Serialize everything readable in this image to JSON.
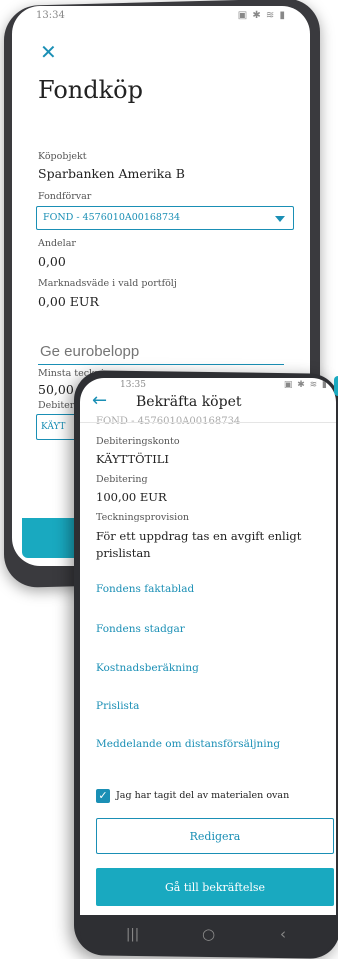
{
  "back_screen": {
    "status_time": "13:34",
    "status_icons": "▣ ✱ ≋ ▮",
    "title": "Fondköp",
    "kopobjekt_label": "Köpobjekt",
    "kopobjekt_value": "Sparbanken Amerika B",
    "fondforvar_label": "Fondförvar",
    "fondforvar_value": "FOND - 4576010A00168734",
    "andelar_label": "Andelar",
    "andelar_value": "0,00",
    "marknadsvarde_label": "Marknadsväde i vald portfölj",
    "marknadsvarde_value": "0,00 EUR",
    "euro_placeholder": "Ge eurobelopp",
    "minsta_label": "Minsta teckning",
    "minsta_value": "50,00 EUR",
    "debitering_partial": "Debiter",
    "kayttotili_partial": "KÄYT"
  },
  "front_screen": {
    "status_time": "13:35",
    "status_icons": "▣ ✱ ≋ ▮",
    "title": "Bekräfta köpet",
    "cut_text": "FOND - 4576010A00168734",
    "debiteringskonto_label": "Debiteringskonto",
    "debiteringskonto_value": "KÄYTTÖTILI",
    "debitering_label": "Debitering",
    "debitering_value": "100,00 EUR",
    "teckningsprovision_label": "Teckningsprovision",
    "teckningsprovision_value": "För ett uppdrag tas en avgift enligt prislistan",
    "links": [
      "Fondens faktablad",
      "Fondens stadgar",
      "Kostnadsberäkning",
      "Prislista",
      "Meddelande om distansförsäljning"
    ],
    "checkbox_label": "Jag har tagit del av materialen ovan",
    "checkbox_checked": true,
    "edit_button": "Redigera",
    "confirm_button": "Gå till bekräftelse"
  },
  "nav": {
    "recent": "|||",
    "home": "○",
    "back": "‹"
  },
  "colors": {
    "accent": "#1a8fb5",
    "button": "#19a9c0",
    "phone_frame": "#2e2f33"
  }
}
